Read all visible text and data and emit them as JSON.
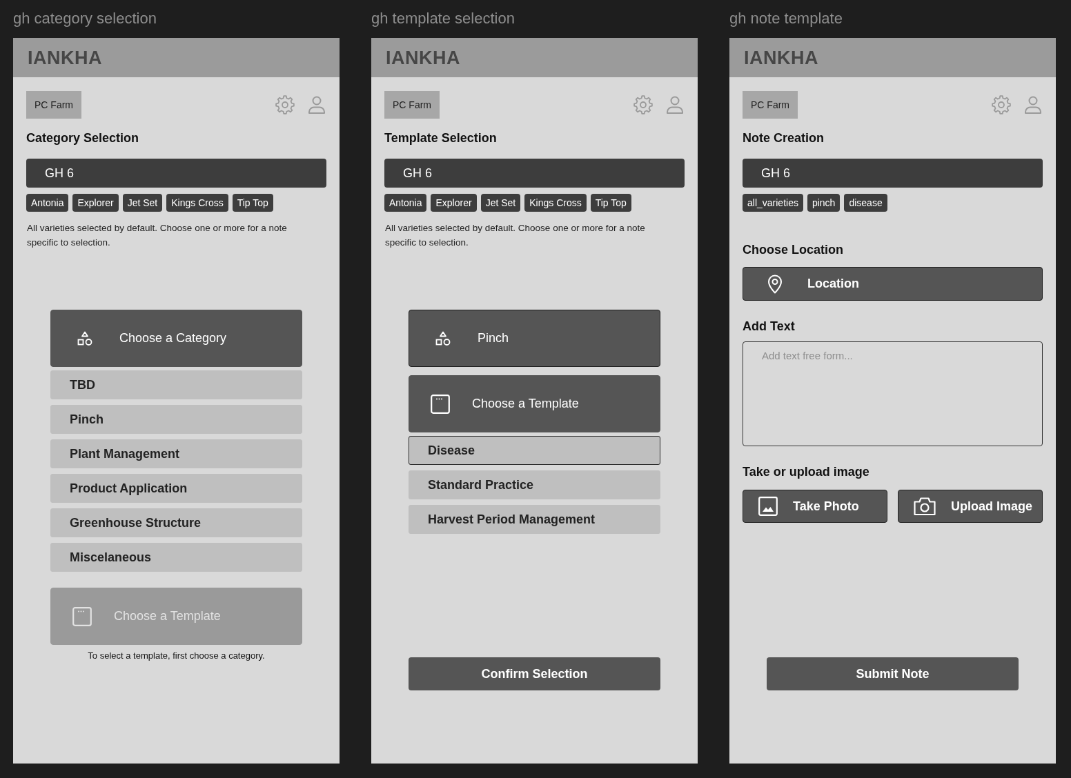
{
  "screens": [
    {
      "kind": "selection",
      "frame_label": "gh category selection",
      "logo": "IANKHA",
      "farm": "PC Farm",
      "title": "Category Selection",
      "greenhouse": "GH 6",
      "tags": [
        "Antonia",
        "Explorer",
        "Jet Set",
        "Kings Cross",
        "Tip Top"
      ],
      "help_text": "All varieties selected by default. Choose one or more for a note specific to selection.",
      "content": [
        {
          "kind": "category_dropdown",
          "label": "Choose a Category",
          "focused": false,
          "disabled": false,
          "options": [
            {
              "label": "TBD",
              "selected": false
            },
            {
              "label": "Pinch",
              "selected": false
            },
            {
              "label": "Plant Management",
              "selected": false
            },
            {
              "label": "Product Application",
              "selected": false
            },
            {
              "label": "Greenhouse Structure",
              "selected": false
            },
            {
              "label": "Miscelaneous",
              "selected": false
            }
          ]
        },
        {
          "kind": "template_dropdown",
          "label": "Choose a Template",
          "focused": false,
          "disabled": true
        },
        {
          "kind": "hint",
          "text": "To select a template, first choose a category."
        }
      ]
    },
    {
      "kind": "selection",
      "frame_label": "gh template selection",
      "logo": "IANKHA",
      "farm": "PC Farm",
      "title": "Template Selection",
      "greenhouse": "GH 6",
      "tags": [
        "Antonia",
        "Explorer",
        "Jet Set",
        "Kings Cross",
        "Tip Top"
      ],
      "help_text": "All varieties selected by default. Choose one or more for a note specific to selection.",
      "content": [
        {
          "kind": "category_dropdown",
          "label": "Pinch",
          "focused": true,
          "disabled": false
        },
        {
          "kind": "template_dropdown",
          "label": "Choose a Template",
          "focused": false,
          "disabled": false,
          "options": [
            {
              "label": "Disease",
              "selected": true
            },
            {
              "label": "Standard Practice",
              "selected": false
            },
            {
              "label": "Harvest Period Management",
              "selected": false
            }
          ]
        },
        {
          "kind": "primary_button",
          "label": "Confirm Selection"
        }
      ]
    },
    {
      "kind": "form",
      "frame_label": "gh note template",
      "logo": "IANKHA",
      "farm": "PC Farm",
      "title": "Note Creation",
      "greenhouse": "GH 6",
      "tags": [
        "all_varieties",
        "pinch",
        "disease"
      ],
      "content": [
        {
          "kind": "heading",
          "text": "Choose Location"
        },
        {
          "kind": "location_button",
          "label": "Location"
        },
        {
          "kind": "heading",
          "text": "Add Text"
        },
        {
          "kind": "text_area",
          "placeholder": "Add text free form..."
        },
        {
          "kind": "heading",
          "text": "Take or upload image"
        },
        {
          "kind": "image_buttons",
          "buttons": [
            {
              "kind": "take_photo",
              "label": "Take Photo"
            },
            {
              "kind": "upload_image",
              "label": "Upload Image"
            }
          ]
        },
        {
          "kind": "primary_button",
          "label": "Submit Note"
        }
      ]
    }
  ]
}
